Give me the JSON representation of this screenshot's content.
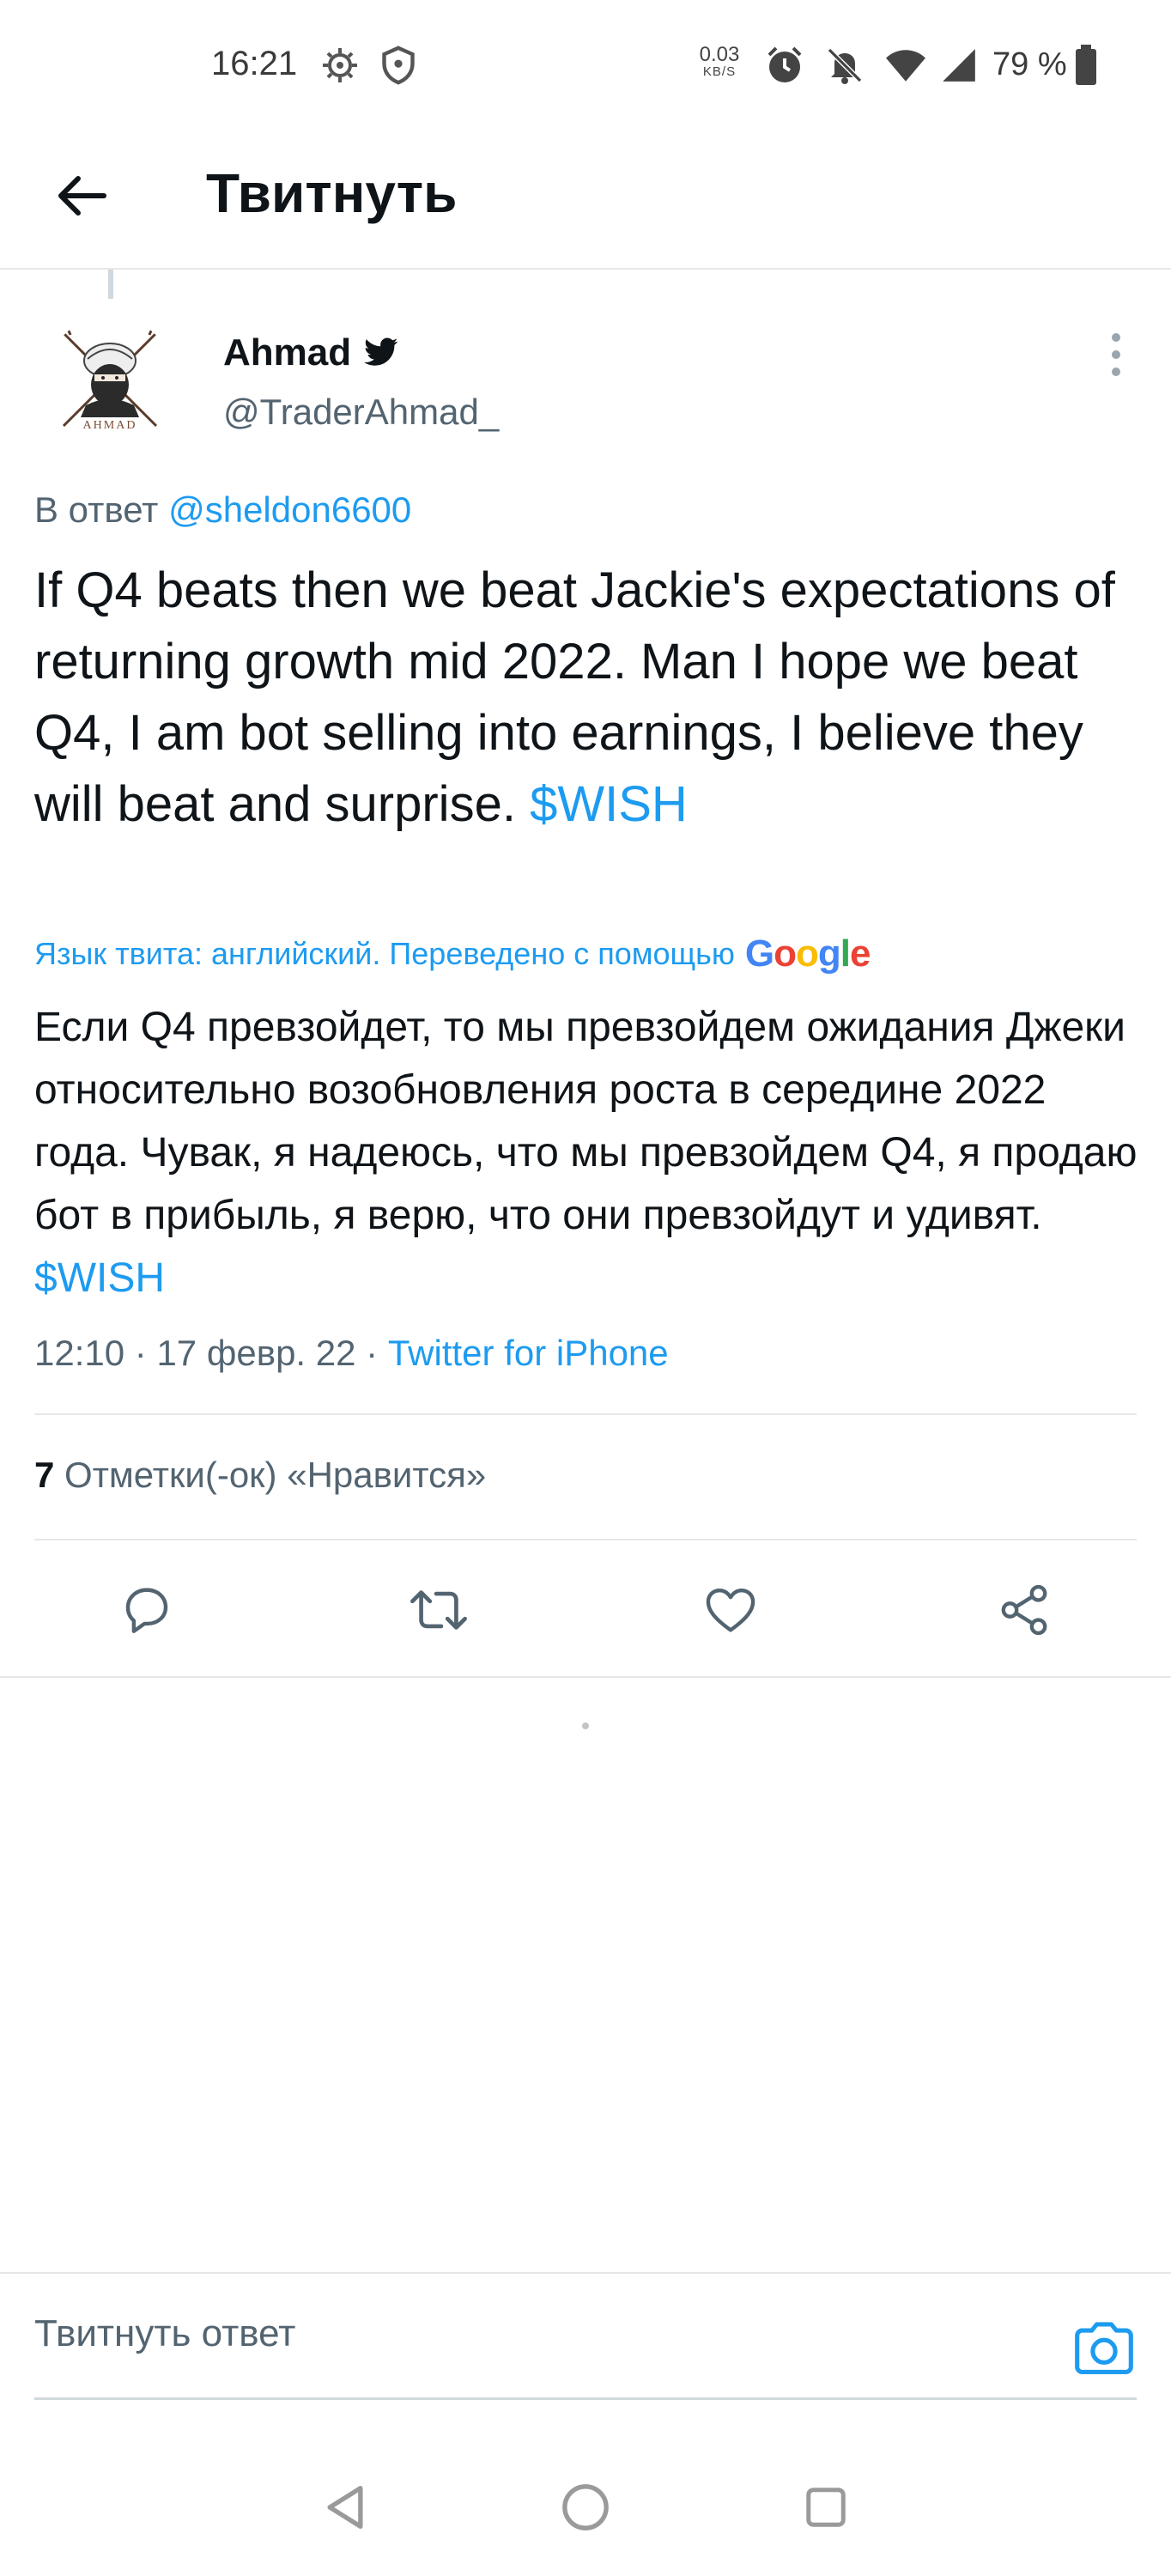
{
  "status_bar": {
    "time": "16:21",
    "network_speed_value": "0.03",
    "network_speed_unit": "KB/S",
    "battery": "79 %",
    "icons": [
      "settings-gear-icon",
      "shield-icon",
      "alarm-icon",
      "notifications-off-icon",
      "wifi-icon",
      "cellular-signal-icon",
      "battery-icon"
    ]
  },
  "header": {
    "title": "Твитнуть",
    "back_icon": "arrow-left-icon"
  },
  "tweet": {
    "author": {
      "name": "Ahmad",
      "handle": "@TraderAhmad_",
      "avatar_text": "AHMAD",
      "badge_icon": "twitter-bird-icon"
    },
    "reply_prefix": "В ответ",
    "reply_mention": "@sheldon6600",
    "text": "If Q4 beats then we beat Jackie's expectations of returning growth mid 2022. Man I hope we beat Q4, I am bot selling into earnings, I believe they will beat and surprise.",
    "cashtag": "$WISH",
    "translation_note": "Язык твита: английский. Переведено с помощью",
    "translation_provider": "Google",
    "translated_text": "Если Q4 превзойдет, то мы превзойдем ожидания Джеки относительно возобновления роста в середине 2022 года. Чувак, я надеюсь, что мы превзойдем Q4, я продаю бот в прибыль, я верю, что они превзойдут и удивят.",
    "translated_cashtag": "$WISH",
    "time": "12:10",
    "date": "17 февр. 22",
    "separator": "·",
    "source": "Twitter for iPhone",
    "likes_count": "7",
    "likes_label": "Отметки(-ок) «Нравится»"
  },
  "actions": [
    "reply-icon",
    "retweet-icon",
    "like-icon",
    "share-icon"
  ],
  "reply_bar": {
    "placeholder": "Твитнуть ответ"
  },
  "colors": {
    "accent": "#1d9bf0",
    "text_primary": "#0f1419",
    "text_secondary": "#536471",
    "divider": "#e7e7e7"
  }
}
